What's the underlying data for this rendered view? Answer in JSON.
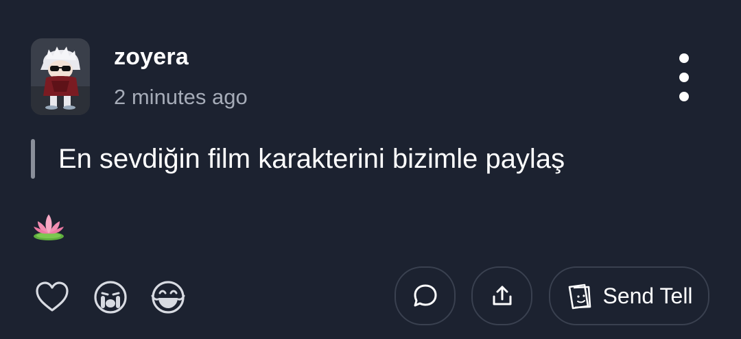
{
  "post": {
    "username": "zoyera",
    "timestamp": "2 minutes ago",
    "text": "En sevdiğin film karakterini bizimle paylaş",
    "emoji": "lotus",
    "avatar": "anime-character-avatar"
  },
  "header": {
    "more_icon": "more-vertical-icon"
  },
  "reactions": [
    {
      "icon": "heart-icon"
    },
    {
      "icon": "crying-face-icon"
    },
    {
      "icon": "laughing-face-icon"
    }
  ],
  "actions": {
    "comment_icon": "comment-icon",
    "share_icon": "share-icon",
    "send_tell_icon": "tell-card-icon",
    "send_tell_label": "Send Tell"
  },
  "colors": {
    "background": "#1c2230",
    "text_primary": "#ffffff",
    "text_secondary": "#a6acb8",
    "border": "#3a4150",
    "quote_bar": "#8a8f9a"
  }
}
